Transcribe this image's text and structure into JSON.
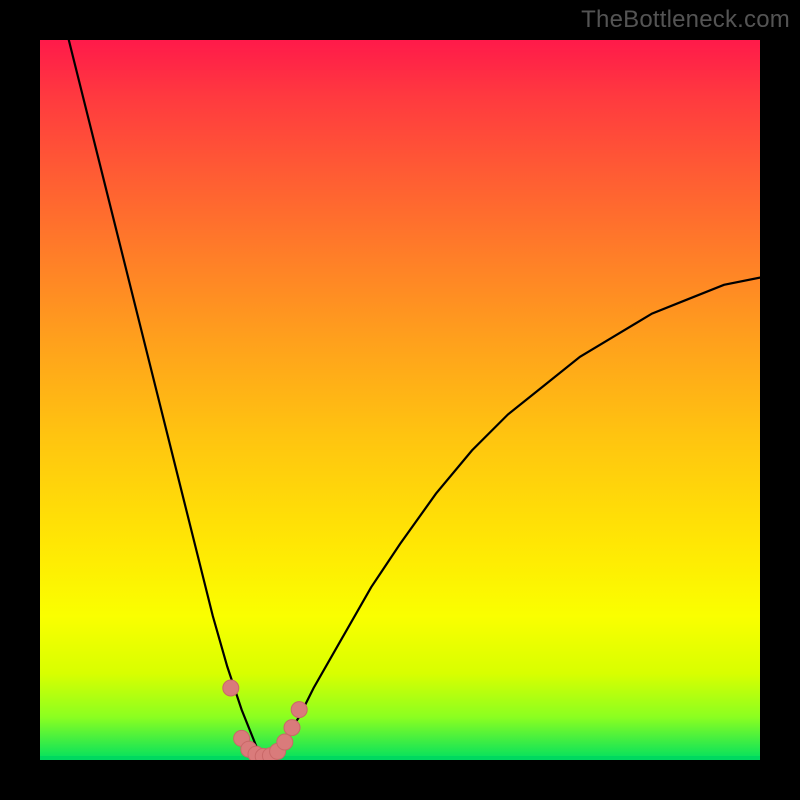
{
  "chart_data": {
    "type": "line",
    "title": "",
    "xlabel": "",
    "ylabel": "",
    "xlim": [
      0,
      100
    ],
    "ylim": [
      0,
      100
    ],
    "watermark": "TheBottleneck.com",
    "background_gradient": {
      "top": "#ff1a4a",
      "mid": "#ffe704",
      "bottom": "#00e060"
    },
    "curve": {
      "description": "V-shaped bottleneck curve; left branch steep from top-left down to trough near x≈31, right branch rises more gently to upper right",
      "x": [
        4,
        6,
        8,
        10,
        12,
        14,
        16,
        18,
        20,
        22,
        24,
        26,
        28,
        30,
        31,
        32,
        34,
        36,
        38,
        42,
        46,
        50,
        55,
        60,
        65,
        70,
        75,
        80,
        85,
        90,
        95,
        100
      ],
      "y": [
        100,
        92,
        84,
        76,
        68,
        60,
        52,
        44,
        36,
        28,
        20,
        13,
        7,
        2,
        0,
        1,
        3,
        6,
        10,
        17,
        24,
        30,
        37,
        43,
        48,
        52,
        56,
        59,
        62,
        64,
        66,
        67
      ]
    },
    "optimal_band": {
      "y_threshold": 2,
      "x_range": [
        27,
        36
      ]
    },
    "markers": {
      "color": "#d97b7b",
      "stroke": "#c96868",
      "radius_px": 8,
      "points": [
        {
          "x": 26.5,
          "y": 10
        },
        {
          "x": 28.0,
          "y": 3
        },
        {
          "x": 29.0,
          "y": 1.5
        },
        {
          "x": 30.0,
          "y": 0.8
        },
        {
          "x": 31.0,
          "y": 0.5
        },
        {
          "x": 32.0,
          "y": 0.6
        },
        {
          "x": 33.0,
          "y": 1.2
        },
        {
          "x": 34.0,
          "y": 2.5
        },
        {
          "x": 35.0,
          "y": 4.5
        },
        {
          "x": 36.0,
          "y": 7
        }
      ]
    }
  }
}
